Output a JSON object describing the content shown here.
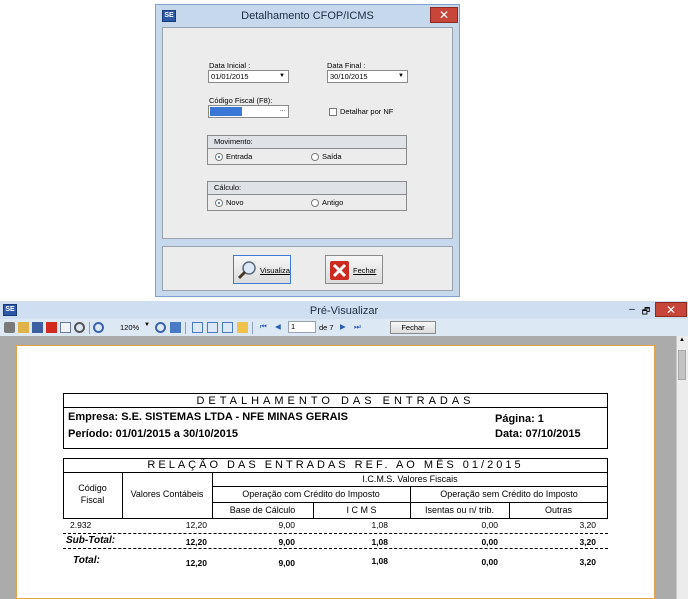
{
  "dialog": {
    "title": "Detalhamento CFOP/ICMS",
    "close_glyph": "✕",
    "date_start_label": "Data Inicial :",
    "date_start_value": "01/01/2015",
    "date_end_label": "Data Final :",
    "date_end_value": "30/10/2015",
    "fiscal_code_label": "Código Fiscal (F8):",
    "fiscal_code_value": "",
    "ellipsis": "...",
    "detail_nf_label": "Detalhar por NF",
    "movement": {
      "title": "Movimento:",
      "options": [
        "Entrada",
        "Saída"
      ],
      "selected": "Entrada"
    },
    "calculation": {
      "title": "Cálculo:",
      "options": [
        "Novo",
        "Antigo"
      ],
      "selected": "Novo"
    },
    "view_button": "Visualiza",
    "close_button": "Fechar"
  },
  "preview": {
    "title": "Pré-Visualizar",
    "window_buttons": [
      "–",
      "🗗",
      "✕"
    ],
    "zoom": "120%",
    "page_current": "1",
    "page_total": "de 7",
    "close_button": "Fechar"
  },
  "report": {
    "title": "DETALHAMENTO DAS ENTRADAS",
    "company": "Empresa: S.E. SISTEMAS LTDA - NFE MINAS GERAIS",
    "page": "Página: 1",
    "period": "Período: 01/01/2015 a 30/10/2015",
    "date": "Data: 07/10/2015",
    "section_title": "RELAÇÃO DAS ENTRADAS REF. AO MÊS 01/2015",
    "headers": {
      "fiscal_code_1": "Código",
      "fiscal_code_2": "Fiscal",
      "accounting": "Valores Contábeis",
      "icms_values": "I.C.M.S. Valores Fiscais",
      "with_credit": "Operação com Crédito do Imposto",
      "without_credit": "Operação sem Crédito do Imposto",
      "base": "Base de Cálculo",
      "icms": "I C M S",
      "exempt": "Isentas ou n/ trib.",
      "others": "Outras"
    },
    "rows": [
      {
        "code": "2.932",
        "accounting": "12,20",
        "base": "9,00",
        "icms": "1,08",
        "exempt": "0,00",
        "others": "3,20"
      }
    ],
    "subtotal": {
      "label": "Sub-Total:",
      "accounting": "12,20",
      "base": "9,00",
      "icms": "1,08",
      "exempt": "0,00",
      "others": "3,20"
    },
    "total": {
      "label": "Total:",
      "accounting": "12,20",
      "base": "9,00",
      "icms": "1,08",
      "exempt": "0,00",
      "others": "3,20"
    }
  }
}
